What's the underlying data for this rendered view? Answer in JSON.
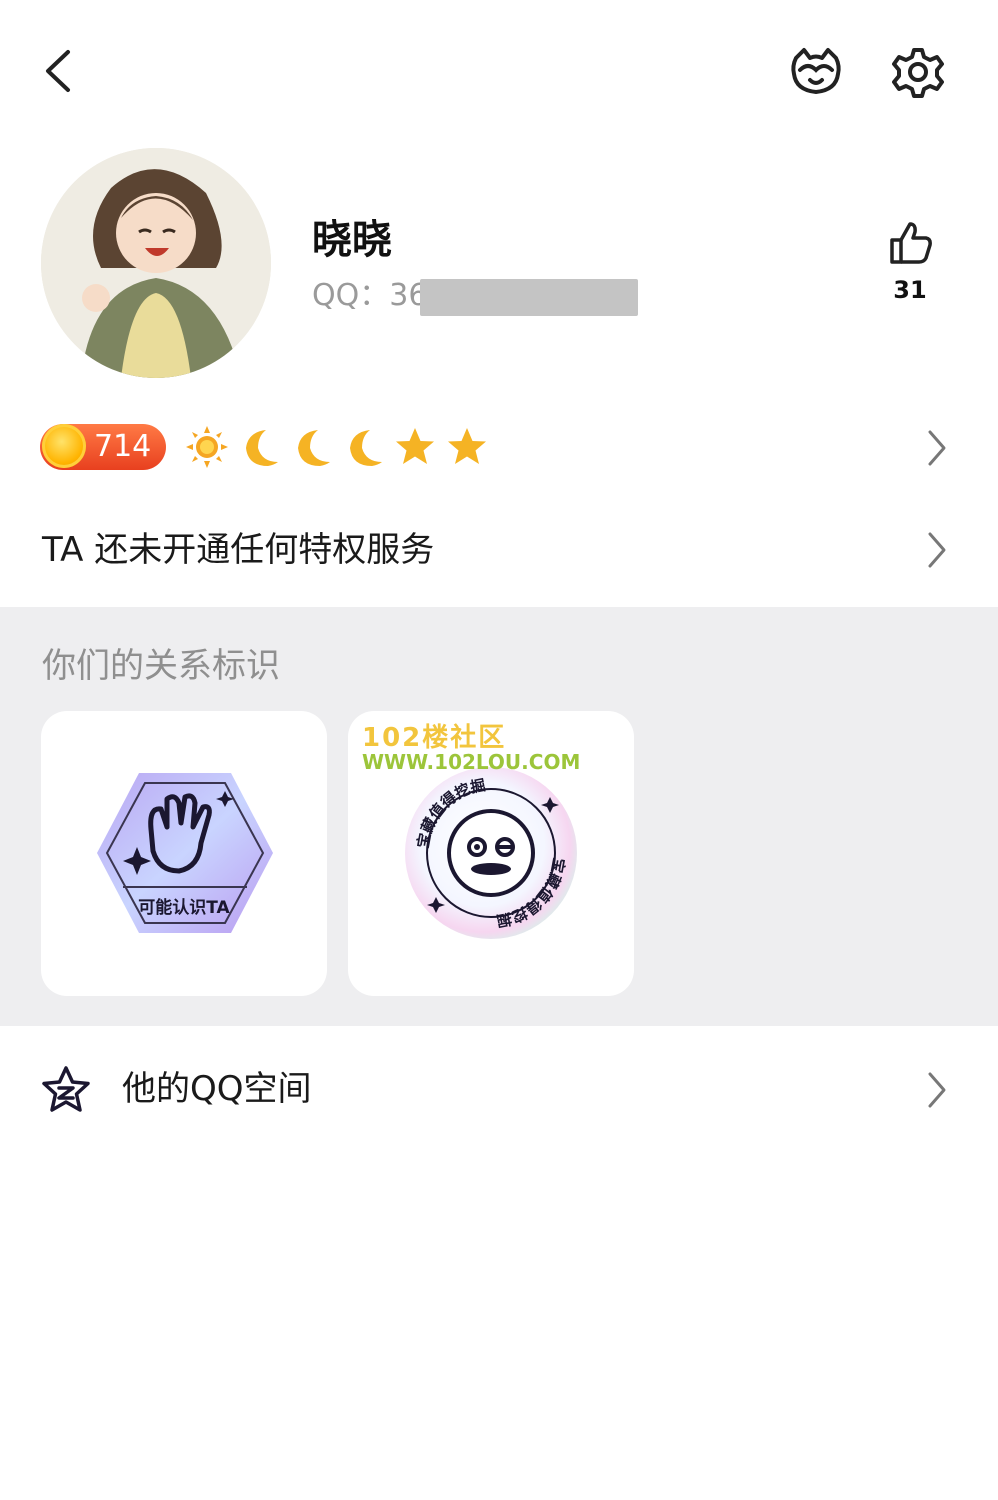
{
  "header": {
    "back_icon": "chevron-left-icon",
    "pet_icon": "cat-face-icon",
    "settings_icon": "gear-icon"
  },
  "profile": {
    "name": "晓晓",
    "qq_label": "QQ：36",
    "likes": "31"
  },
  "level": {
    "value": "714",
    "icons": [
      "sun",
      "moon",
      "moon",
      "moon",
      "star",
      "star"
    ]
  },
  "privilege": {
    "text": "TA 还未开通任何特权服务"
  },
  "relation": {
    "title": "你们的关系标识",
    "cards": [
      {
        "label": "可能认识TA",
        "icon": "waving-hand-icon"
      },
      {
        "label": "宝藏值得挖掘",
        "icon": "smiley-face-icon"
      }
    ],
    "watermark": {
      "line1": "102楼社区",
      "line2": "WWW.102LOU.COM"
    }
  },
  "qzone": {
    "label": "他的QQ空间",
    "icon": "qzone-star-icon"
  },
  "colors": {
    "accent_orange": "#e8401f",
    "coin_gold": "#ffb400",
    "section_bg": "#eeeef0"
  }
}
